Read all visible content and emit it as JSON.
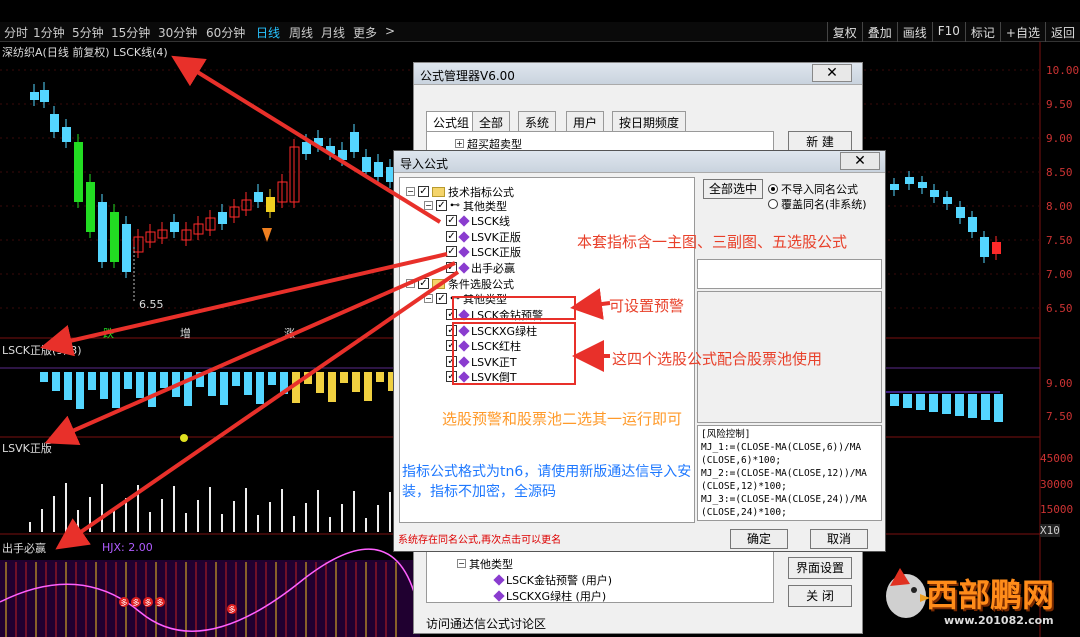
{
  "toolbar": {
    "timeframes": [
      "分时",
      "1分钟",
      "5分钟",
      "15分钟",
      "30分钟",
      "60分钟",
      "日线",
      "周线",
      "月线",
      "更多"
    ],
    "more_arrow": ">",
    "active": "日线",
    "right_buttons": [
      "复权",
      "叠加",
      "画线",
      "F10",
      "标记",
      "+自选",
      "返回"
    ]
  },
  "chart": {
    "title": "深纺织A(日线 前复权) LSCK线(4)",
    "low_label": "6.55",
    "bottom_marks": [
      "跌",
      "增",
      "涨"
    ],
    "sub1_title": "LSCK正版(9, 3)",
    "sub2_title": "LSVK正版",
    "sub3_title": "出手必赢",
    "sub3_value": "HJX: 2.00",
    "axis_main": [
      "10.00",
      "9.50",
      "9.00",
      "8.50",
      "8.00",
      "7.50",
      "7.00",
      "6.50"
    ],
    "axis_sub": [
      "9.00",
      "7.50",
      "45000",
      "30000",
      "15000",
      "X10"
    ],
    "badge_label": "多"
  },
  "formula_manager": {
    "title": "公式管理器V6.00",
    "close": "✕",
    "tabs": [
      "公式组",
      "全部",
      "系统",
      "用户",
      "按日期频度"
    ],
    "tree_top": "超买超卖型",
    "new_button": "新 建",
    "bottom_tree": [
      {
        "label": "其他类型",
        "kind": "group"
      },
      {
        "label": "LSCK金钻预警 (用户)",
        "kind": "item"
      },
      {
        "label": "LSCKXG绿柱  (用户)",
        "kind": "item"
      }
    ],
    "btn_interface": "界面设置",
    "btn_close": "关 闭",
    "forum_link": "访问通达信公式讨论区"
  },
  "import_dialog": {
    "title": "导入公式",
    "close": "✕",
    "tree": [
      {
        "label": "技术指标公式",
        "kind": "folder",
        "level": 0
      },
      {
        "label": "其他类型",
        "kind": "group",
        "level": 1
      },
      {
        "label": "LSCK线",
        "kind": "item",
        "level": 2
      },
      {
        "label": "LSVK正版",
        "kind": "item",
        "level": 2
      },
      {
        "label": "LSCK正版",
        "kind": "item",
        "level": 2
      },
      {
        "label": "出手必赢",
        "kind": "item",
        "level": 2
      },
      {
        "label": "条件选股公式",
        "kind": "folder",
        "level": 0
      },
      {
        "label": "其他类型",
        "kind": "group",
        "level": 1
      },
      {
        "label": "LSCK金钻预警",
        "kind": "item",
        "level": 2
      },
      {
        "label": "LSCKXG绿柱",
        "kind": "item",
        "level": 2
      },
      {
        "label": "LSCK红柱",
        "kind": "item",
        "level": 2
      },
      {
        "label": "LSVK正T",
        "kind": "item",
        "level": 2
      },
      {
        "label": "LSVK倒T",
        "kind": "item",
        "level": 2
      }
    ],
    "select_all": "全部选中",
    "radio_no_import": "不导入同名公式",
    "radio_overwrite": "覆盖同名(非系统)",
    "code": "[风险控制]\nMJ_1:=(CLOSE-MA(CLOSE,6))/MA\n(CLOSE,6)*100;\nMJ_2:=(CLOSE-MA(CLOSE,12))/MA\n(CLOSE,12)*100;\nMJ_3:=(CLOSE-MA(CLOSE,24))/MA\n(CLOSE,24)*100;",
    "status": "系统存在同名公式,再次点击可以更名",
    "ok": "确定",
    "cancel": "取消"
  },
  "annotations": {
    "a1": "本套指标含一主图、三副图、五选股公式",
    "a2": "可设置预警",
    "a3": "这四个选股公式配合股票池使用",
    "a4": "选股预警和股票池二选其一运行即可",
    "a5": "指标公式格式为tn6，请使用新版通达信导入安装，指标不加密，全源码"
  },
  "watermark": {
    "text": "西部鹏网",
    "url": "www.201082.com"
  },
  "colors": {
    "up": "#ff2a2a",
    "down": "#54d6ff",
    "green": "#22dd22",
    "annotation_red": "#e8402a",
    "annotation_blue": "#1e78ff",
    "annotation_orange": "#ff9a2a"
  }
}
